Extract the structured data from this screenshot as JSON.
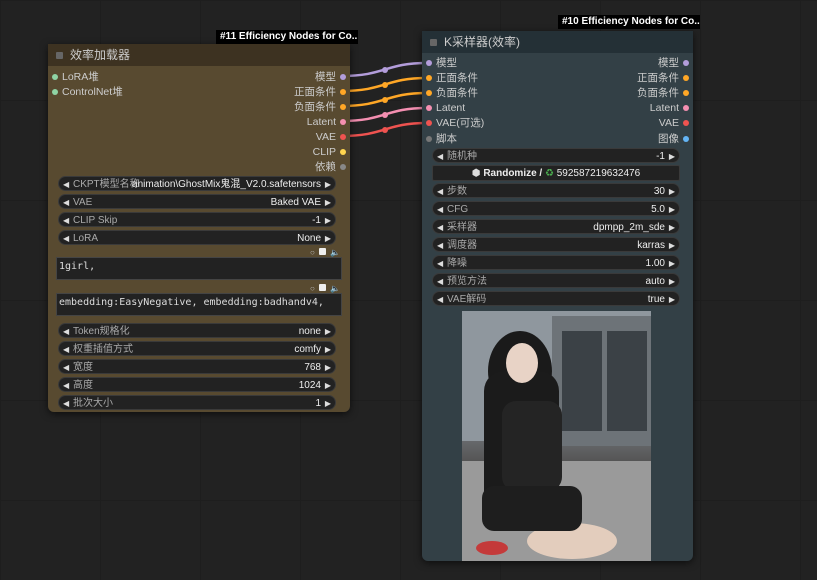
{
  "node11": {
    "badge": "#11 Efficiency Nodes for Co..",
    "title": "效率加载器",
    "inputs": [
      {
        "label": "LoRA堆",
        "color": "#8fd4a4"
      },
      {
        "label": "ControlNet堆",
        "color": "#8fd4a4"
      }
    ],
    "outputs": [
      {
        "label": "模型",
        "color": "#b39ddb"
      },
      {
        "label": "正面条件",
        "color": "#ffa726"
      },
      {
        "label": "负面条件",
        "color": "#ffa726"
      },
      {
        "label": "Latent",
        "color": "#f48fb1"
      },
      {
        "label": "VAE",
        "color": "#ef5350"
      },
      {
        "label": "CLIP",
        "color": "#ffd54f"
      },
      {
        "label": "依赖",
        "color": "#888888"
      }
    ],
    "widgets1": [
      {
        "label": "CKPT模型名称",
        "value": "animation\\GhostMix鬼混_V2.0.safetensors"
      },
      {
        "label": "VAE",
        "value": "Baked VAE"
      },
      {
        "label": "CLIP Skip",
        "value": "-1"
      },
      {
        "label": "LoRA",
        "value": "None"
      }
    ],
    "positive_text": "1girl,",
    "negative_text": "embedding:EasyNegative, embedding:badhandv4,",
    "widgets2": [
      {
        "label": "Token规格化",
        "value": "none"
      },
      {
        "label": "权重插值方式",
        "value": "comfy"
      },
      {
        "label": "宽度",
        "value": "768"
      },
      {
        "label": "高度",
        "value": "1024"
      },
      {
        "label": "批次大小",
        "value": "1"
      }
    ]
  },
  "node10": {
    "badge": "#10 Efficiency Nodes for Co..",
    "title": "K采样器(效率)",
    "io_rows": [
      {
        "in": "模型",
        "in_color": "#b39ddb",
        "out": "模型",
        "out_color": "#b39ddb"
      },
      {
        "in": "正面条件",
        "in_color": "#ffa726",
        "out": "正面条件",
        "out_color": "#ffa726"
      },
      {
        "in": "负面条件",
        "in_color": "#ffa726",
        "out": "负面条件",
        "out_color": "#ffa726"
      },
      {
        "in": "Latent",
        "in_color": "#f48fb1",
        "out": "Latent",
        "out_color": "#f48fb1"
      },
      {
        "in": "VAE(可选)",
        "in_color": "#ef5350",
        "out": "VAE",
        "out_color": "#ef5350"
      },
      {
        "in": "脚本",
        "in_color": "#777777",
        "out": "图像",
        "out_color": "#64b5f6"
      }
    ],
    "seed": {
      "label": "随机种",
      "value": "-1"
    },
    "randomize_label": "Randomize / ",
    "seed_number": "592587219632476",
    "widgets": [
      {
        "label": "步数",
        "value": "30"
      },
      {
        "label": "CFG",
        "value": "5.0"
      },
      {
        "label": "采样器",
        "value": "dpmpp_2m_sde"
      },
      {
        "label": "调度器",
        "value": "karras"
      },
      {
        "label": "降噪",
        "value": "1.00"
      },
      {
        "label": "预览方法",
        "value": "auto"
      },
      {
        "label": "VAE解码",
        "value": "true"
      }
    ]
  }
}
